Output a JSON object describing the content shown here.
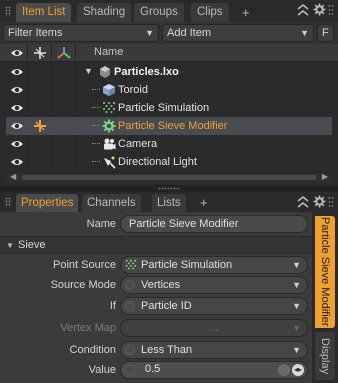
{
  "top_tabs": [
    {
      "label": "Item List",
      "active": true
    },
    {
      "label": "Shading",
      "active": false
    },
    {
      "label": "Groups",
      "active": false
    },
    {
      "label": "Clips",
      "active": false
    }
  ],
  "add_tab_symbol": "+",
  "filter": {
    "filter_label": "Filter Items",
    "add_item_label": "Add Item",
    "f_button": "F"
  },
  "list": {
    "column_name": "Name",
    "rows": [
      {
        "label": "Particles.lxo",
        "icon": "scene-icon"
      },
      {
        "label": "Toroid",
        "icon": "mesh-cube-icon"
      },
      {
        "label": "Particle Simulation",
        "icon": "particle-sim-icon"
      },
      {
        "label": "Particle Sieve Modifier",
        "icon": "gear-modifier-icon"
      },
      {
        "label": "Camera",
        "icon": "camera-icon"
      },
      {
        "label": "Directional Light",
        "icon": "light-icon"
      }
    ]
  },
  "prop_tabs": [
    {
      "label": "Properties",
      "active": true
    },
    {
      "label": "Channels",
      "active": false
    },
    {
      "label": "Lists",
      "active": false
    }
  ],
  "properties": {
    "name_label": "Name",
    "name_value": "Particle Sieve Modifier",
    "section_label": "Sieve",
    "fields": [
      {
        "label": "Point Source",
        "value": "Particle Simulation"
      },
      {
        "label": "Source Mode",
        "value": "Vertices"
      },
      {
        "label": "If",
        "value": "Particle ID"
      },
      {
        "label": "Vertex Map",
        "value": "..."
      },
      {
        "label": "Condition",
        "value": "Less Than"
      }
    ],
    "value_label": "Value",
    "value_value": "0.5"
  },
  "side_tabs": [
    {
      "label": "Particle Sieve Modifier",
      "active": true
    },
    {
      "label": "Display",
      "active": false
    }
  ],
  "colors": {
    "accent": "#f0a030",
    "panel": "#3b3b3b",
    "selected_row": "#484c52"
  }
}
